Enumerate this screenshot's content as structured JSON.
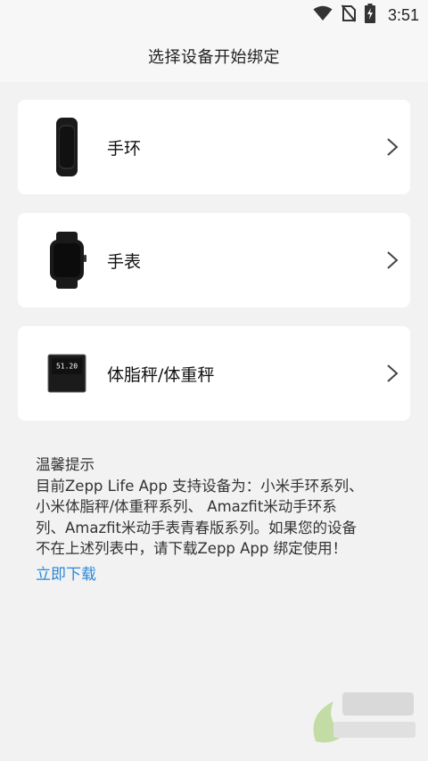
{
  "status_bar": {
    "time": "3:51",
    "icons": [
      "wifi-icon",
      "no-sim-icon",
      "battery-charging-icon"
    ]
  },
  "header": {
    "title": "选择设备开始绑定"
  },
  "devices": [
    {
      "label": "手环",
      "icon": "band-device-icon"
    },
    {
      "label": "手表",
      "icon": "watch-device-icon"
    },
    {
      "label": "体脂秤/体重秤",
      "icon": "scale-device-icon",
      "display_reading": "51.20"
    }
  ],
  "notes": {
    "title": "温馨提示",
    "body": "目前Zepp Life App 支持设备为：小米手环系列、\n小米体脂秤/体重秤系列、 Amazfit米动手环系\n列、Amazfit米动手表青春版系列。如果您的设备\n不在上述列表中，请下载Zepp App 绑定使用！",
    "download_link": "立即下载"
  },
  "colors": {
    "background": "#f2f2f2",
    "card": "#ffffff",
    "link": "#2b87d8",
    "text": "#111111"
  }
}
